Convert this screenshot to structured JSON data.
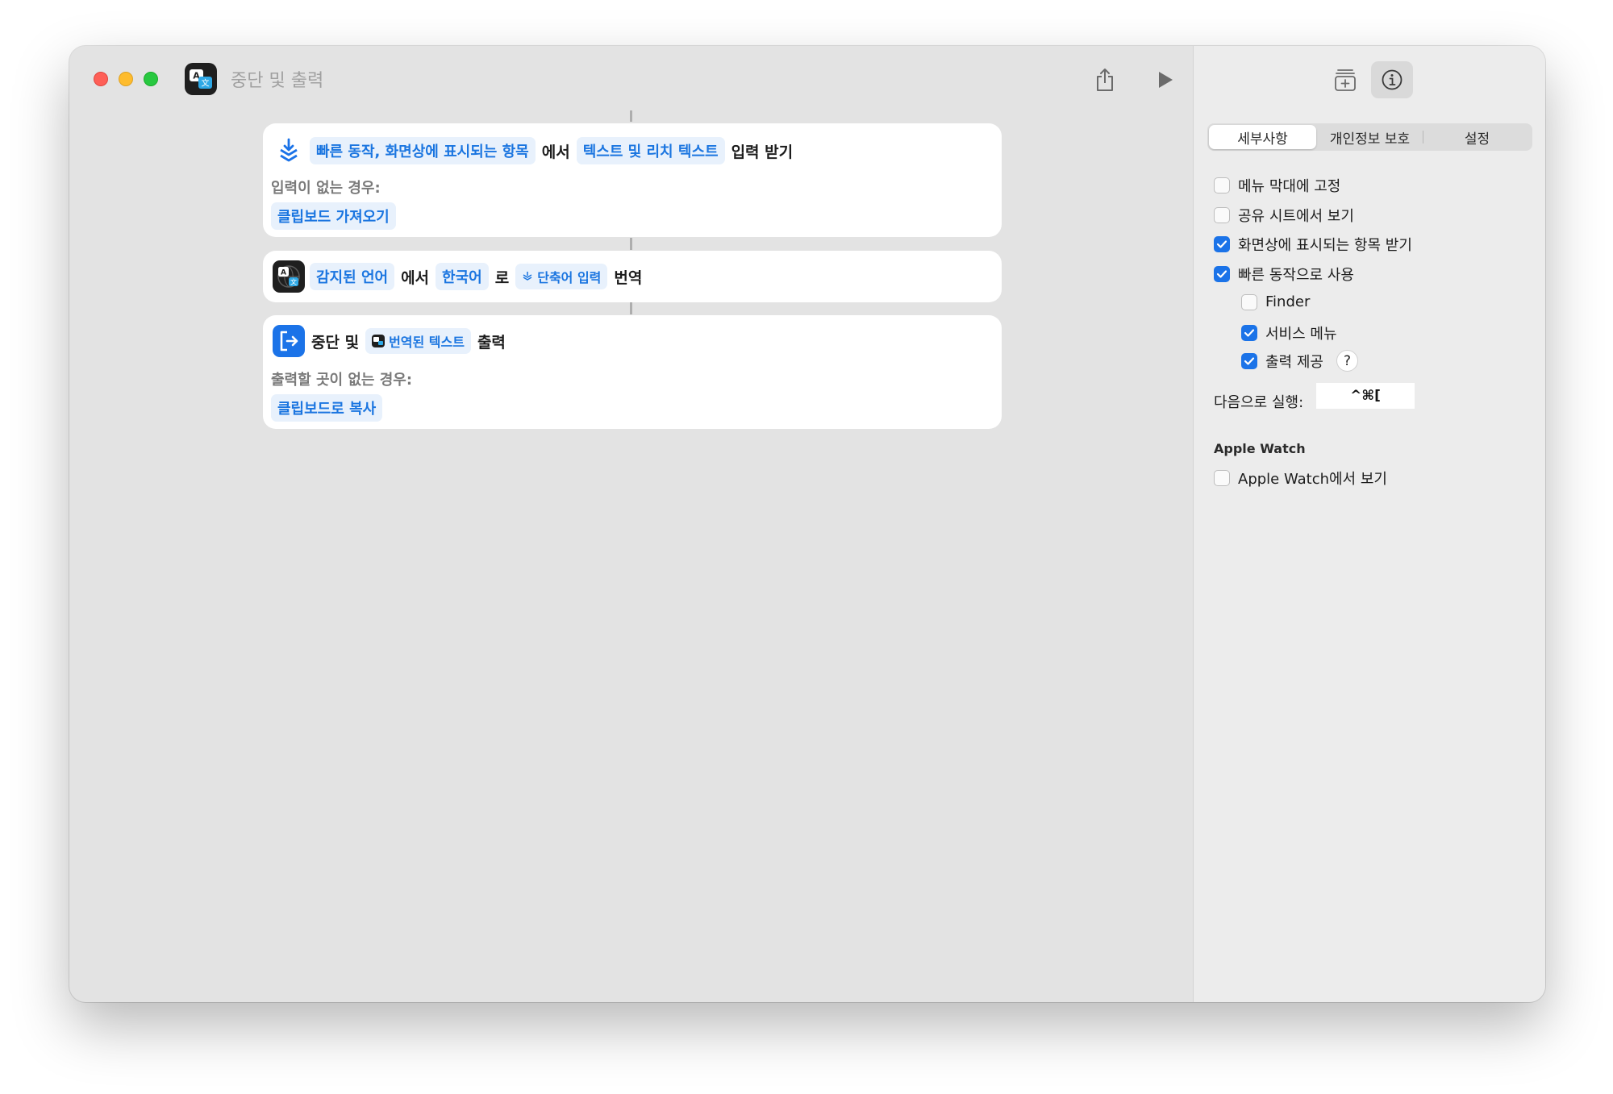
{
  "window": {
    "title": "중단 및 출력"
  },
  "actions": {
    "receive": {
      "tokens": [
        "빠른 동작, 화면상에 표시되는 항목",
        "텍스트 및 리치 텍스트"
      ],
      "words": [
        "에서",
        "입력 받기"
      ],
      "fallback_label": "입력이 없는 경우:",
      "fallback_token": "클립보드 가져오기"
    },
    "translate": {
      "from_token": "감지된 언어",
      "word_from": "에서",
      "to_token": "한국어",
      "word_to": "로",
      "input_token": "단축어 입력",
      "word_action": "번역"
    },
    "stop": {
      "word_stop": "중단 및",
      "output_token": "번역된 텍스트",
      "word_output": "출력",
      "fallback_label": "출력할 곳이 없는 경우:",
      "fallback_token": "클립보드로 복사"
    }
  },
  "sidebar": {
    "tabs": [
      "세부사항",
      "개인정보 보호",
      "설정"
    ],
    "active_tab": "세부사항",
    "options": [
      {
        "label": "메뉴 막대에 고정",
        "checked": false
      },
      {
        "label": "공유 시트에서 보기",
        "checked": false
      },
      {
        "label": "화면상에 표시되는 항목 받기",
        "checked": true
      },
      {
        "label": "빠른 동작으로 사용",
        "checked": true
      },
      {
        "label": "Finder",
        "checked": false
      },
      {
        "label": "서비스 메뉴",
        "checked": true
      },
      {
        "label": "출력 제공",
        "checked": true
      }
    ],
    "help_glyph": "?",
    "run_with_label": "다음으로 실행:",
    "shortcut_value": "^⌘[",
    "apple_watch_heading": "Apple Watch",
    "apple_watch_option": {
      "label": "Apple Watch에서 보기",
      "checked": false
    }
  },
  "colors": {
    "accent": "#1b73e8",
    "token_bg": "#e8f1fc",
    "token_text": "#1a75e0"
  }
}
